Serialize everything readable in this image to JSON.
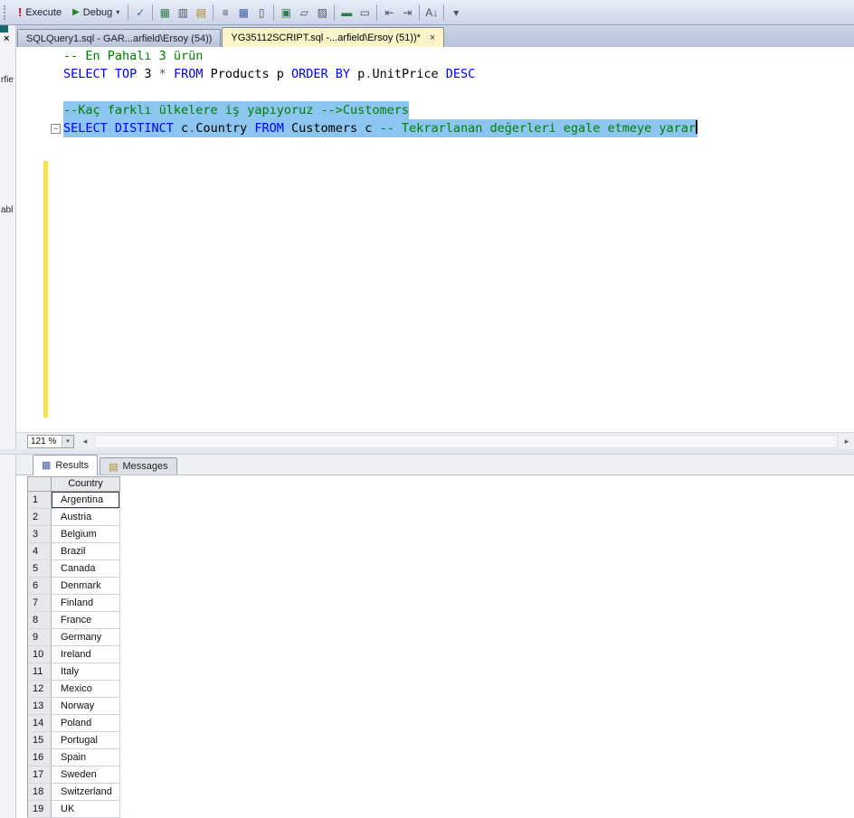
{
  "colors": {
    "keyword": "#0000ff",
    "comment": "#008000",
    "operator": "#555555",
    "plain": "#000000",
    "selection": "#8cc5f0",
    "change_bar": "#f5e14a"
  },
  "glyphs": {
    "down": "▾",
    "left": "◂",
    "right": "▸",
    "fold": "−"
  },
  "toolbar": {
    "execute_label": "Execute",
    "execute_glyph": "!",
    "debug_label": "Debug",
    "debug_glyph": "▶",
    "debug_dropdown_glyph": "▾",
    "icons": [
      {
        "name": "parse-check-icon",
        "glyph": "✓",
        "color": "#2f6bbf",
        "sep_before": true
      },
      {
        "name": "estimated-plan-icon",
        "glyph": "▦",
        "color": "#2e7d46",
        "sep_before": true
      },
      {
        "name": "query-designer-icon",
        "glyph": "▥",
        "color": "#4a5363",
        "sep_before": false
      },
      {
        "name": "template-notebook-icon",
        "glyph": "▤",
        "color": "#b08a1f",
        "sep_before": false
      },
      {
        "name": "results-to-text-icon",
        "glyph": "≡",
        "color": "#4a5363",
        "sep_before": true
      },
      {
        "name": "results-to-grid-icon",
        "glyph": "▦",
        "color": "#3c5aa0",
        "sep_before": false
      },
      {
        "name": "results-to-file-icon",
        "glyph": "▯",
        "color": "#4a5363",
        "sep_before": false
      },
      {
        "name": "actual-plan-icon",
        "glyph": "▣",
        "color": "#2e7d46",
        "sep_before": true
      },
      {
        "name": "client-statistics-icon",
        "glyph": "▱",
        "color": "#4a5363",
        "sep_before": false
      },
      {
        "name": "sqlcmd-mode-icon",
        "glyph": "▨",
        "color": "#4a5363",
        "sep_before": false
      },
      {
        "name": "comment-lines-icon",
        "glyph": "▬",
        "color": "#2e7d46",
        "sep_before": true
      },
      {
        "name": "uncomment-lines-icon",
        "glyph": "▭",
        "color": "#4a5363",
        "sep_before": false
      },
      {
        "name": "decrease-indent-icon",
        "glyph": "⇤",
        "color": "#4a5363",
        "sep_before": true
      },
      {
        "name": "increase-indent-icon",
        "glyph": "⇥",
        "color": "#4a5363",
        "sep_before": false
      },
      {
        "name": "sort-az-icon",
        "glyph": "A↓",
        "color": "#4a5363",
        "sep_before": true
      },
      {
        "name": "toolbar-overflow-icon",
        "glyph": "▾",
        "color": "#4a5363",
        "sep_before": true
      }
    ]
  },
  "doc_tabs": [
    {
      "label": "SQLQuery1.sql - GAR...arfield\\Ersoy (54))",
      "active": false
    },
    {
      "label": "YG35112SCRIPT.sql -...arfield\\Ersoy (51))*",
      "active": true,
      "close_glyph": "×"
    }
  ],
  "left_panel": {
    "close_glyph": "×",
    "fragments": [
      "rfie",
      "abl"
    ]
  },
  "editor": {
    "zoom": "121 %",
    "lines": [
      {
        "selected": false,
        "tokens": [
          {
            "text": "-- En Pahalı 3 ürün",
            "type": "comment"
          }
        ]
      },
      {
        "selected": false,
        "tokens": [
          {
            "text": "SELECT TOP ",
            "type": "keyword"
          },
          {
            "text": "3 ",
            "type": "plain"
          },
          {
            "text": "* ",
            "type": "operator"
          },
          {
            "text": "FROM",
            "type": "keyword"
          },
          {
            "text": " Products p ",
            "type": "plain"
          },
          {
            "text": "ORDER BY",
            "type": "keyword"
          },
          {
            "text": " p",
            "type": "plain"
          },
          {
            "text": ".",
            "type": "operator"
          },
          {
            "text": "UnitPrice ",
            "type": "plain"
          },
          {
            "text": "DESC",
            "type": "keyword"
          }
        ]
      },
      {
        "selected": false,
        "tokens": []
      },
      {
        "selected": true,
        "tokens": [
          {
            "text": "--Kaç farklı ülkelere iş yapıyoruz -->Customers",
            "type": "comment"
          }
        ]
      },
      {
        "selected": true,
        "cursor": true,
        "tokens": [
          {
            "text": "SELECT DISTINCT",
            "type": "keyword"
          },
          {
            "text": " c",
            "type": "plain"
          },
          {
            "text": ".",
            "type": "operator"
          },
          {
            "text": "Country ",
            "type": "plain"
          },
          {
            "text": "FROM",
            "type": "keyword"
          },
          {
            "text": " Customers c ",
            "type": "plain"
          },
          {
            "text": "-- Tekrarlanan değerleri egale etmeye yarar",
            "type": "comment"
          }
        ]
      }
    ]
  },
  "results": {
    "tabs": [
      {
        "label": "Results",
        "active": true,
        "icon": "results-grid-icon",
        "glyph": "▦",
        "icon_color": "#3c5aa0"
      },
      {
        "label": "Messages",
        "active": false,
        "icon": "messages-icon",
        "glyph": "▤",
        "icon_color": "#b08a1f"
      }
    ],
    "grid": {
      "column": "Country",
      "rows": [
        "Argentina",
        "Austria",
        "Belgium",
        "Brazil",
        "Canada",
        "Denmark",
        "Finland",
        "France",
        "Germany",
        "Ireland",
        "Italy",
        "Mexico",
        "Norway",
        "Poland",
        "Portugal",
        "Spain",
        "Sweden",
        "Switzerland",
        "UK"
      ]
    }
  }
}
